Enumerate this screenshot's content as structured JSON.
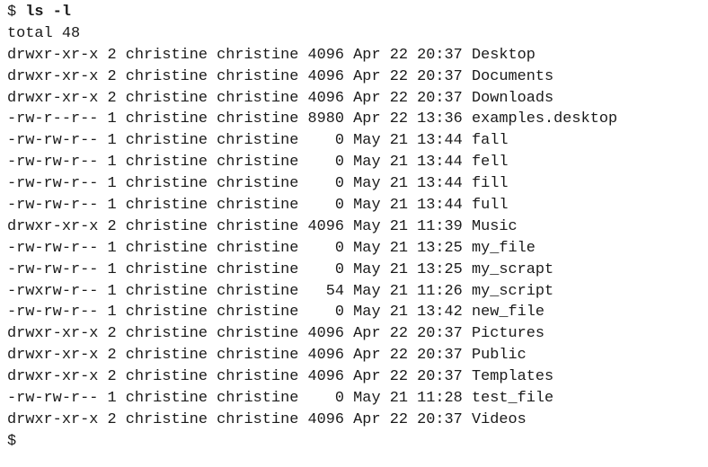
{
  "terminal": {
    "prompt": "$ ",
    "command": "ls -l",
    "total": "total 48",
    "rows": [
      {
        "text": "drwxr-xr-x 2 christine christine 4096 Apr 22 20:37 Desktop"
      },
      {
        "text": "drwxr-xr-x 2 christine christine 4096 Apr 22 20:37 Documents"
      },
      {
        "text": "drwxr-xr-x 2 christine christine 4096 Apr 22 20:37 Downloads"
      },
      {
        "text": "-rw-r--r-- 1 christine christine 8980 Apr 22 13:36 examples.desktop"
      },
      {
        "text": "-rw-rw-r-- 1 christine christine    0 May 21 13:44 fall"
      },
      {
        "text": "-rw-rw-r-- 1 christine christine    0 May 21 13:44 fell"
      },
      {
        "text": "-rw-rw-r-- 1 christine christine    0 May 21 13:44 fill"
      },
      {
        "text": "-rw-rw-r-- 1 christine christine    0 May 21 13:44 full"
      },
      {
        "text": "drwxr-xr-x 2 christine christine 4096 May 21 11:39 Music"
      },
      {
        "text": "-rw-rw-r-- 1 christine christine    0 May 21 13:25 my_file"
      },
      {
        "text": "-rw-rw-r-- 1 christine christine    0 May 21 13:25 my_scrapt"
      },
      {
        "text": "-rwxrw-r-- 1 christine christine   54 May 21 11:26 my_script"
      },
      {
        "text": "-rw-rw-r-- 1 christine christine    0 May 21 13:42 new_file"
      },
      {
        "text": "drwxr-xr-x 2 christine christine 4096 Apr 22 20:37 Pictures"
      },
      {
        "text": "drwxr-xr-x 2 christine christine 4096 Apr 22 20:37 Public"
      },
      {
        "text": "drwxr-xr-x 2 christine christine 4096 Apr 22 20:37 Templates"
      },
      {
        "text": "-rw-rw-r-- 1 christine christine    0 May 21 11:28 test_file"
      },
      {
        "text": "drwxr-xr-x 2 christine christine 4096 Apr 22 20:37 Videos"
      }
    ],
    "final_prompt": "$"
  }
}
